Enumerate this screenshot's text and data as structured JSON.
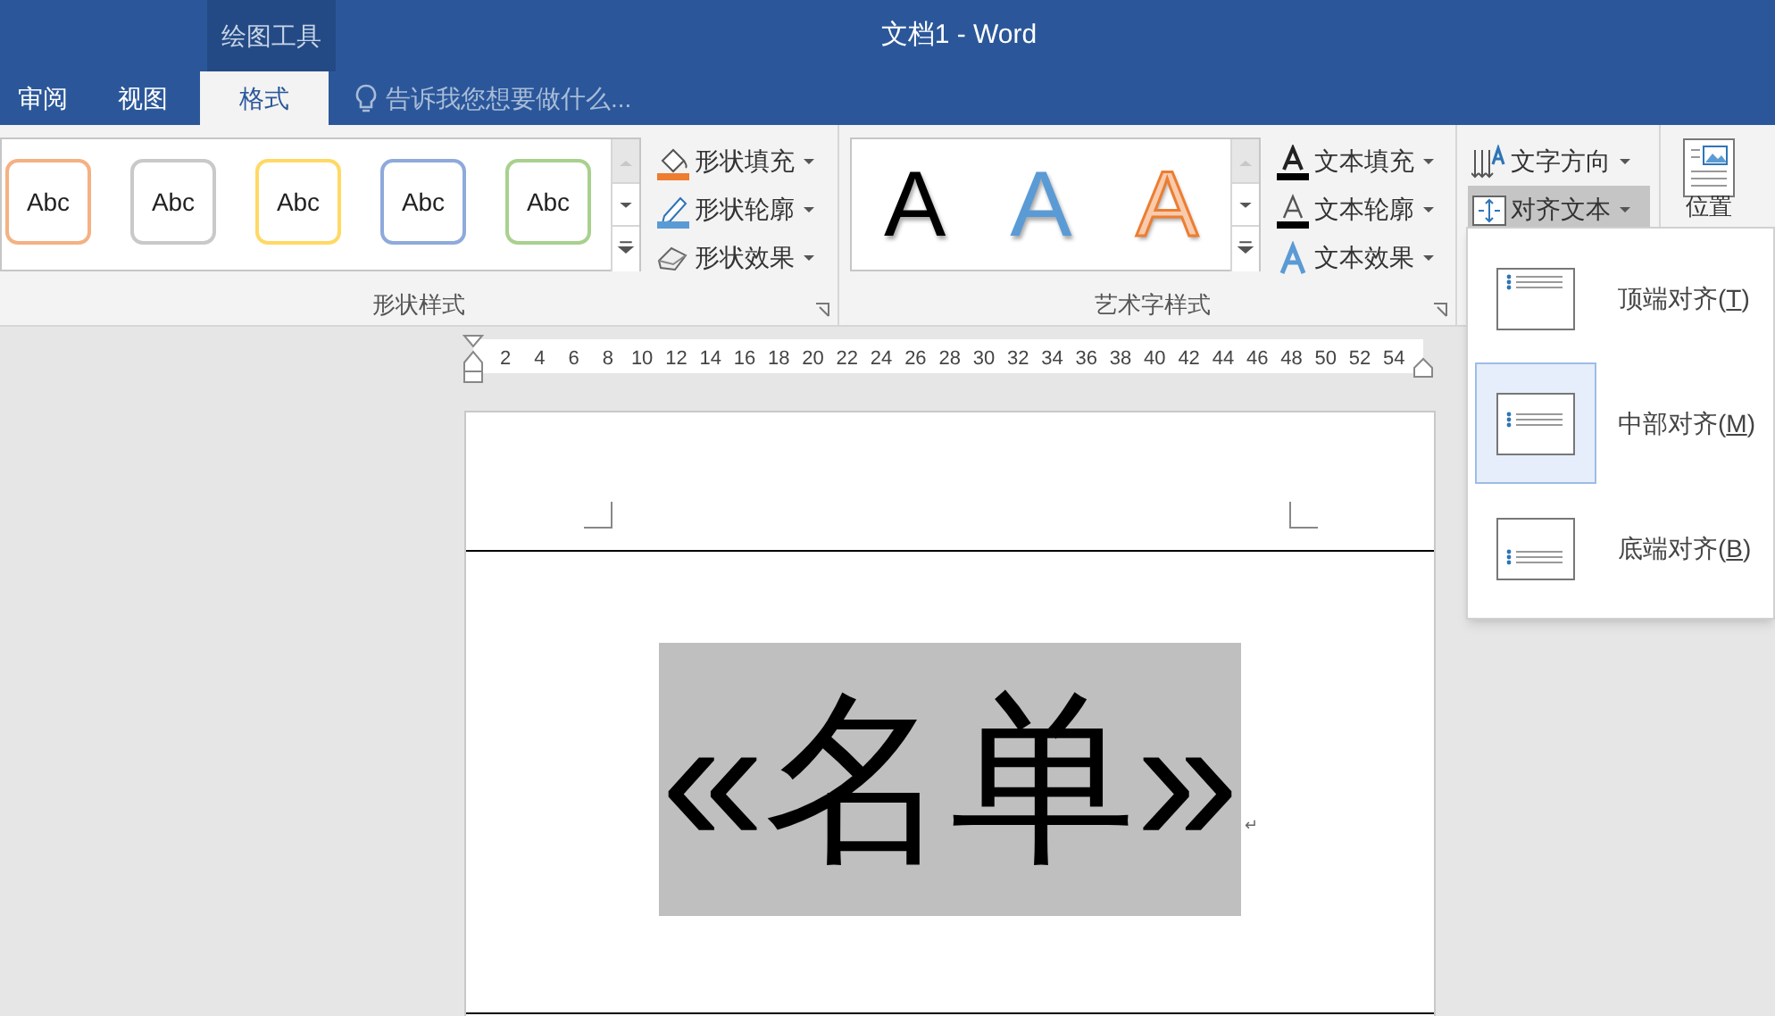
{
  "window": {
    "title": "文档1 - Word",
    "context_group": "绘图工具"
  },
  "tabs": [
    {
      "label": "审阅",
      "selected": false
    },
    {
      "label": "视图",
      "selected": false
    },
    {
      "label": "格式",
      "selected": true
    }
  ],
  "tell_me": {
    "placeholder": "告诉我您想要做什么..."
  },
  "shape_styles": {
    "label": "形状样式",
    "swatches": [
      {
        "text": "Abc",
        "color": "#f4b183"
      },
      {
        "text": "Abc",
        "color": "#c9c9c9"
      },
      {
        "text": "Abc",
        "color": "#ffd966"
      },
      {
        "text": "Abc",
        "color": "#8eaadb"
      },
      {
        "text": "Abc",
        "color": "#a9d18e"
      }
    ],
    "commands": [
      {
        "label": "形状填充",
        "kind": "fill"
      },
      {
        "label": "形状轮廓",
        "kind": "outline"
      },
      {
        "label": "形状效果",
        "kind": "effect"
      }
    ]
  },
  "wordart_styles": {
    "label": "艺术字样式",
    "samples": [
      {
        "text": "A",
        "kind": "filled",
        "color": "#000000"
      },
      {
        "text": "A",
        "kind": "filled",
        "color": "#5b9bd5"
      },
      {
        "text": "A",
        "kind": "outlined",
        "color": "#f8cbad"
      }
    ],
    "commands": [
      {
        "label": "文本填充",
        "kind": "fill"
      },
      {
        "label": "文本轮廓",
        "kind": "outline"
      },
      {
        "label": "文本效果",
        "kind": "effect"
      }
    ]
  },
  "arrange": {
    "commands": [
      {
        "label": "文字方向",
        "kind": "direction",
        "selected": false
      },
      {
        "label": "对齐文本",
        "kind": "align",
        "selected": true
      }
    ]
  },
  "position": {
    "label": "位置"
  },
  "ruler": {
    "ticks": [
      "2",
      "4",
      "6",
      "8",
      "10",
      "12",
      "14",
      "16",
      "18",
      "20",
      "22",
      "24",
      "26",
      "28",
      "30",
      "32",
      "34",
      "36",
      "38",
      "40",
      "42",
      "44",
      "46",
      "48",
      "50",
      "52",
      "54"
    ]
  },
  "document": {
    "text": "«名单»",
    "paragraph_mark": "↵"
  },
  "align_menu": {
    "items": [
      {
        "prefix": "顶端对齐(",
        "key": "T",
        "suffix": ")",
        "kind": "top",
        "selected": false
      },
      {
        "prefix": "中部对齐(",
        "key": "M",
        "suffix": ")",
        "kind": "middle",
        "selected": true
      },
      {
        "prefix": "底端对齐(",
        "key": "B",
        "suffix": ")",
        "kind": "bottom",
        "selected": false
      }
    ]
  }
}
